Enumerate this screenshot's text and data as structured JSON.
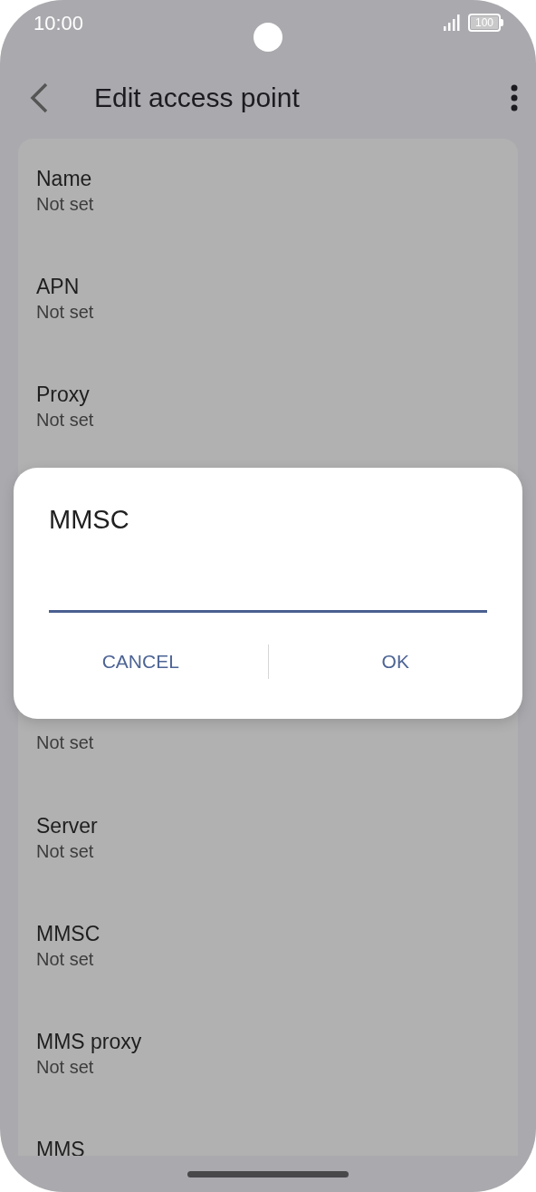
{
  "status_bar": {
    "time": "10:00",
    "battery": "100"
  },
  "header": {
    "title": "Edit access point"
  },
  "settings_list": [
    {
      "label": "Name",
      "value": "Not set"
    },
    {
      "label": "APN",
      "value": "Not set"
    },
    {
      "label": "Proxy",
      "value": "Not set"
    }
  ],
  "settings_list_below_dialog": [
    {
      "value": "Not set"
    },
    {
      "label": "Server",
      "value": "Not set"
    },
    {
      "label": "MMSC",
      "value": "Not set"
    },
    {
      "label": "MMS proxy",
      "value": "Not set"
    },
    {
      "label": "MMS"
    }
  ],
  "dialog": {
    "title": "MMSC",
    "buttons": [
      "CANCEL",
      "OK"
    ]
  }
}
